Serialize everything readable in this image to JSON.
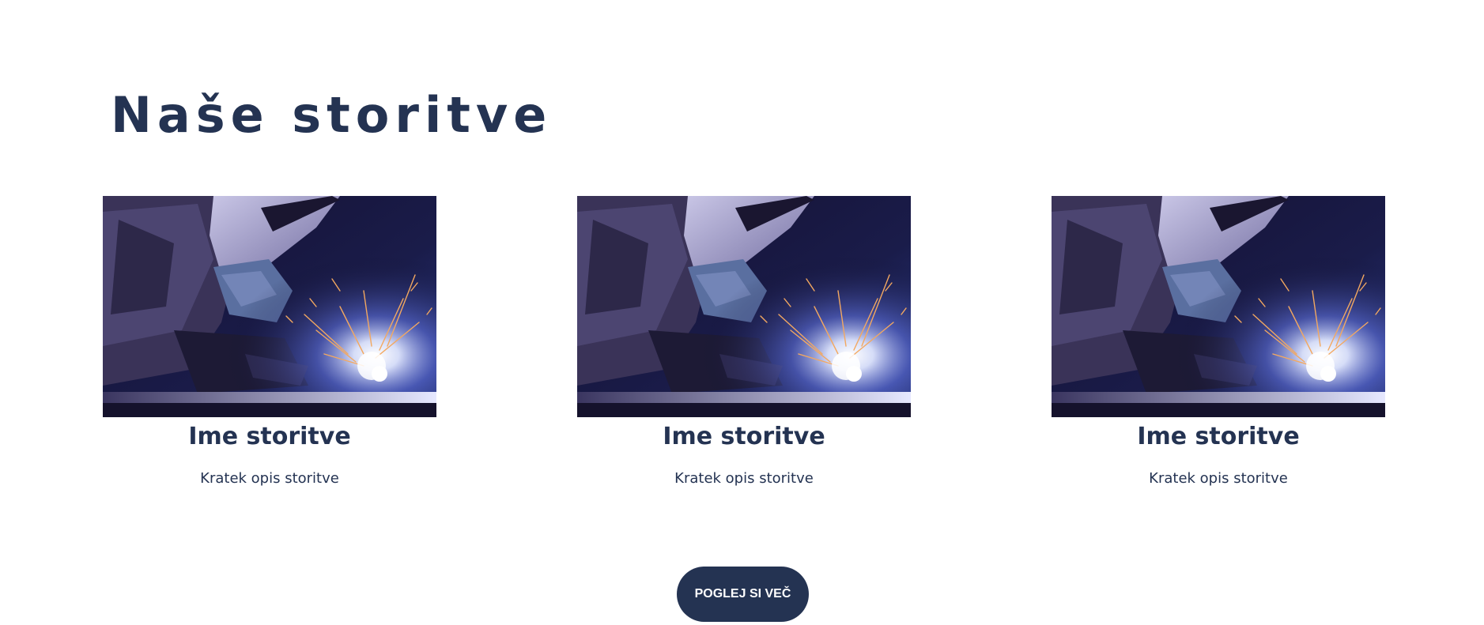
{
  "section": {
    "title": "Naše storitve"
  },
  "services": [
    {
      "title": "Ime storitve",
      "description": "Kratek opis storitve",
      "image": "welder-sparks-photo"
    },
    {
      "title": "Ime storitve",
      "description": "Kratek opis storitve",
      "image": "welder-sparks-photo"
    },
    {
      "title": "Ime storitve",
      "description": "Kratek opis storitve",
      "image": "welder-sparks-photo"
    }
  ],
  "cta": {
    "label": "POGLEJ SI VEČ"
  },
  "colors": {
    "primary": "#243352",
    "background": "#ffffff",
    "button_text": "#ffffff"
  }
}
